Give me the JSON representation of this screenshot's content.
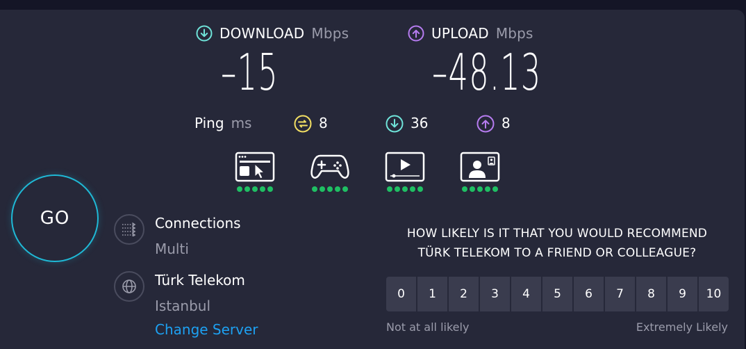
{
  "download": {
    "label": "DOWNLOAD",
    "unit": "Mbps",
    "value": "–15"
  },
  "upload": {
    "label": "UPLOAD",
    "unit": "Mbps",
    "value": "–48.13"
  },
  "ping": {
    "label": "Ping",
    "unit": "ms",
    "idle": "8",
    "download": "36",
    "upload": "8"
  },
  "experience": {
    "browsing_rating": 5,
    "gaming_rating": 5,
    "streaming_rating": 5,
    "video_chat_rating": 5
  },
  "go_button": "GO",
  "connections": {
    "title": "Connections",
    "value": "Multi"
  },
  "server": {
    "provider": "Türk Telekom",
    "location": "Istanbul",
    "change_link": "Change Server"
  },
  "survey": {
    "question_line1": "HOW LIKELY IS IT THAT YOU WOULD RECOMMEND",
    "question_line2": "TÜRK TELEKOM TO A FRIEND OR COLLEAGUE?",
    "options": [
      "0",
      "1",
      "2",
      "3",
      "4",
      "5",
      "6",
      "7",
      "8",
      "9",
      "10"
    ],
    "low_label": "Not at all likely",
    "high_label": "Extremely Likely"
  },
  "colors": {
    "accent_download": "#6fe3d9",
    "accent_upload": "#b67cf0",
    "go_ring": "#1fb9d6",
    "rating_dot": "#1fbf63",
    "link": "#1da1f2"
  }
}
